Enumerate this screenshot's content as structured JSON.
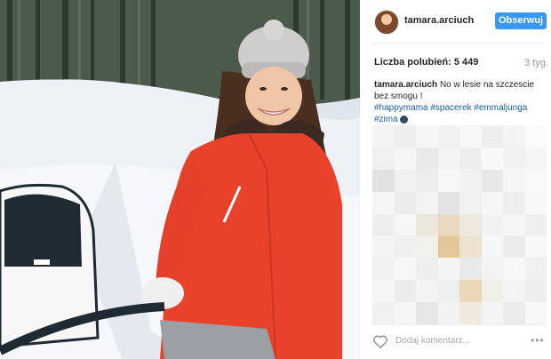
{
  "post": {
    "username": "tamara.arciuch",
    "follow_label": "Obserwuj",
    "likes_label": "Liczba polubień: 5 449",
    "time_ago": "3 tyg.",
    "caption": {
      "user": "tamara.arciuch",
      "text": "No w lesie na szczescie bez smogu !",
      "tags": [
        "#happymama",
        "#spacerek",
        "#emmaljunga",
        "#zima"
      ]
    },
    "comment_placeholder": "Dodaj komentarz...",
    "more_label": "•••"
  },
  "colors": {
    "follow_button": "#3897f0",
    "hashtag": "#1a5c9e",
    "jacket": "#e8432a"
  }
}
